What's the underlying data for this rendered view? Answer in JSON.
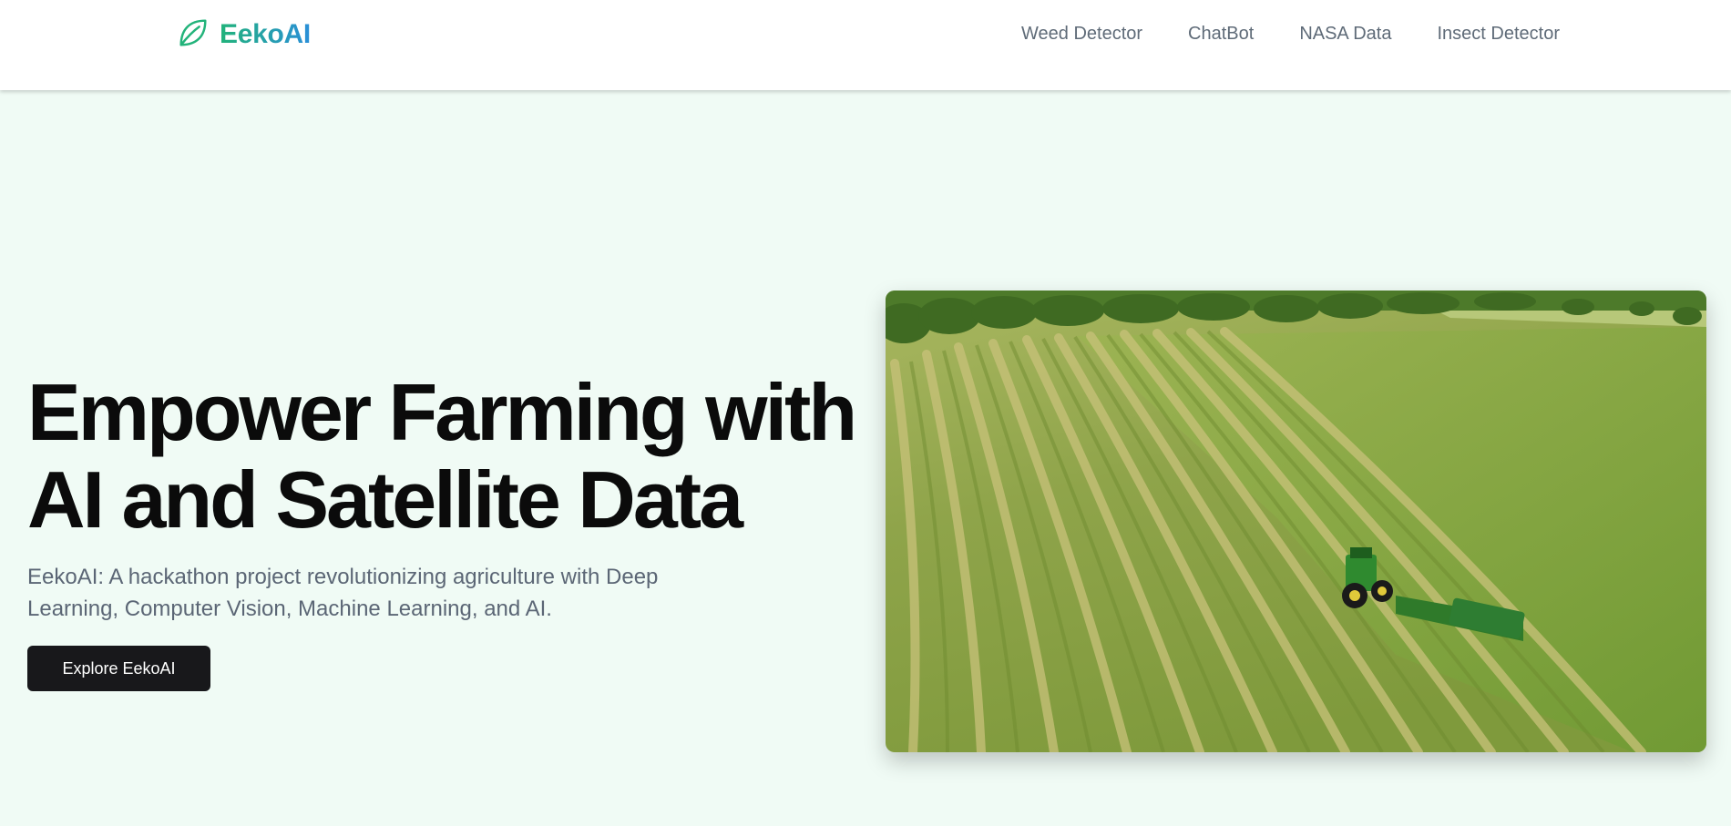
{
  "brand": {
    "name": "EekoAI",
    "icon": "leaf-icon"
  },
  "nav": {
    "items": [
      {
        "label": "Weed Detector"
      },
      {
        "label": "ChatBot"
      },
      {
        "label": "NASA Data"
      },
      {
        "label": "Insect Detector"
      }
    ]
  },
  "hero": {
    "title_line1": "Empower Farming with",
    "title_line2": "AI and Satellite Data",
    "subtitle": "EekoAI: A hackathon project revolutionizing agriculture with Deep Learning, Computer Vision, Machine Learning, and AI.",
    "cta_label": "Explore EekoAI",
    "media": "aerial-farm-field-video"
  },
  "colors": {
    "background": "#f0fbf5",
    "brand_gradient_start": "#22b37a",
    "brand_gradient_end": "#2a8fd8",
    "cta_background": "#18181b",
    "nav_text": "#5f6b78"
  }
}
